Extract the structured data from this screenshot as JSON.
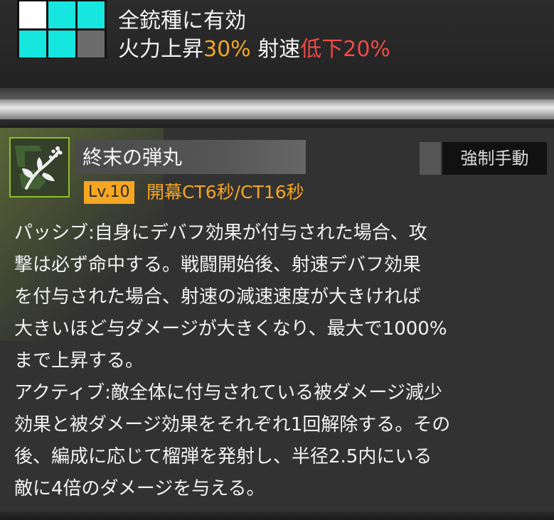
{
  "range_grid": {
    "cells": [
      "white",
      "cyan",
      "cyan",
      "cyan",
      "cyan",
      "gray"
    ]
  },
  "effect": {
    "line1": "全銃種に有効",
    "line2_prefix": "火力上昇",
    "line2_value": "30%",
    "line2_middle": "射速",
    "line2_debuff": "低下20%"
  },
  "skill": {
    "icon": "rifle-bullet-icon",
    "name": "終末の弾丸",
    "level": "Lv.10",
    "cooldown": "開幕CT6秒/CT16秒",
    "forced_activation_label": "強制手動",
    "description": "パッシブ:自身にデバフ効果が付与された場合、攻\n撃は必ず命中する。戦闘開始後、射速デバフ効果\nを付与された場合、射速の減速速度が大きければ\n大きいほど与ダメージが大きくなり、最大で1000%\nまで上昇する。\nアクティブ:敵全体に付与されている被ダメージ減少\n効果と被ダメージ効果をそれぞれ1回解除する。その\n後、編成に応じて榴弾を発射し、半径2.5内にいる\n敵に4倍のダメージを与える。"
  },
  "colors": {
    "accent_orange": "#f5a623",
    "debuff_red": "#ef4a46",
    "grid_cyan": "#16e6e0",
    "icon_border": "#8fbf2a"
  }
}
